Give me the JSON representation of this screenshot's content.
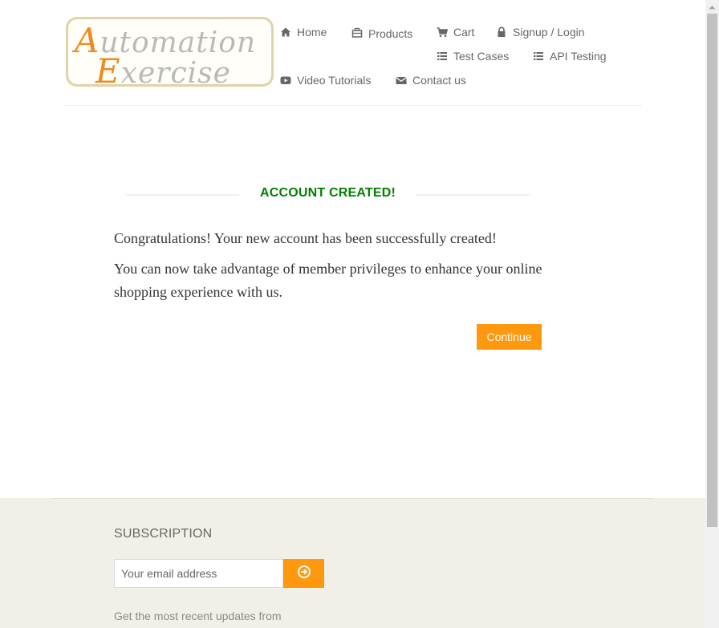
{
  "logo": {
    "line1_cap": "A",
    "line1_rest": "utomation",
    "line2_cap": "E",
    "line2_rest": "xercise"
  },
  "nav": {
    "home": "Home",
    "products": "Products",
    "cart": "Cart",
    "signup_login": "Signup / Login",
    "test_cases": "Test Cases",
    "api_testing": "API Testing",
    "video_tutorials": "Video Tutorials",
    "contact_us": "Contact us"
  },
  "main": {
    "title": "ACCOUNT CREATED!",
    "message1": "Congratulations! Your new account has been successfully created!",
    "message2": "You can now take advantage of member privileges to enhance your online shopping experience with us.",
    "continue_label": "Continue"
  },
  "footer": {
    "subscription_title": "SUBSCRIPTION",
    "email_placeholder": "Your email address",
    "subscribe_note": "Get the most recent updates from"
  },
  "colors": {
    "accent": "#fe980f",
    "title_green": "#008000",
    "footer_bg": "#f0f0e9",
    "nav_text": "#696763"
  },
  "icons": {
    "home": "home-icon",
    "products": "products-icon",
    "cart": "cart-icon",
    "login": "lock-icon",
    "test_cases": "list-icon",
    "api_testing": "list-icon",
    "video": "youtube-play-icon",
    "contact": "envelope-icon",
    "subscribe": "arrow-circle-right-icon"
  }
}
